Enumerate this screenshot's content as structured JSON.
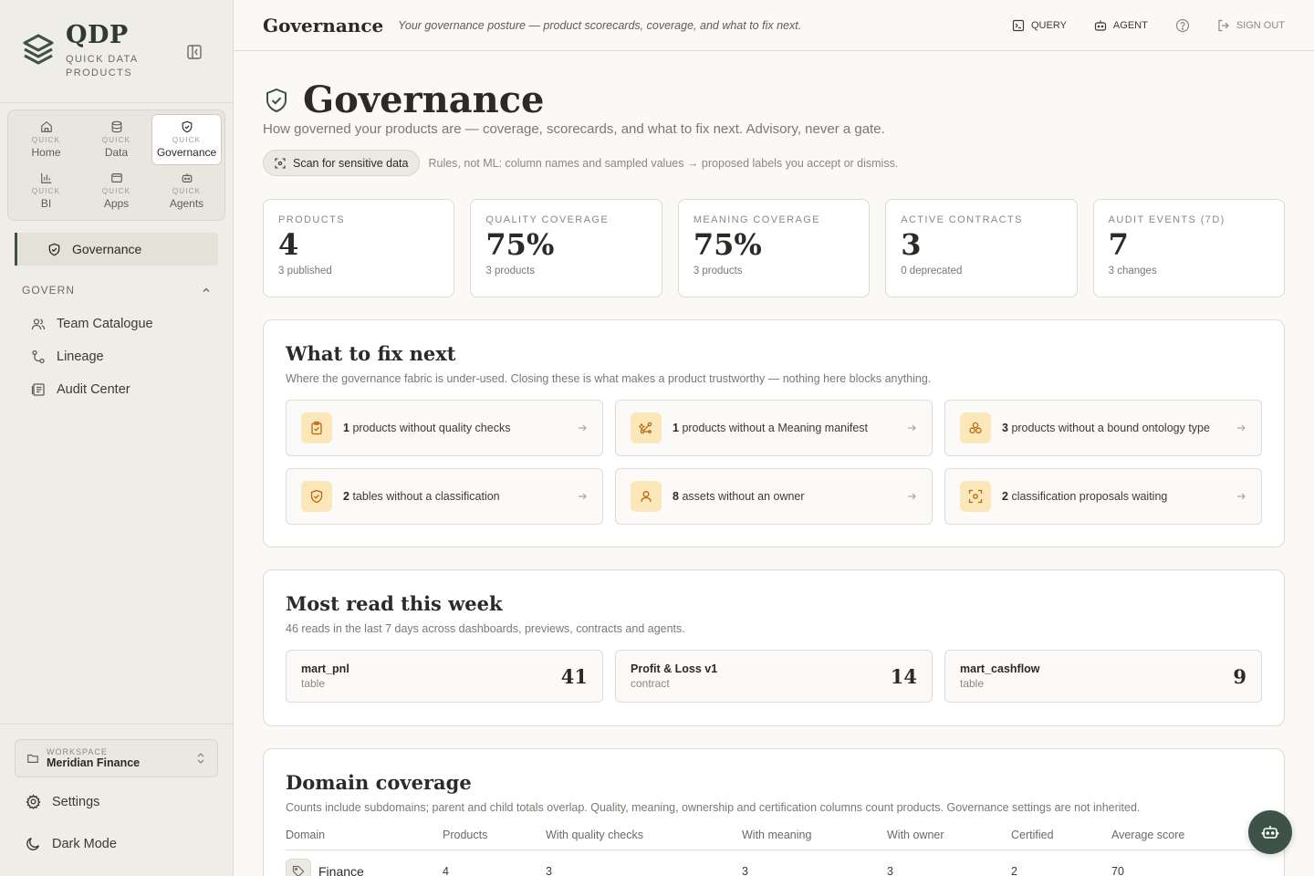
{
  "brand": {
    "title": "QDP",
    "subtitle": "QUICK DATA PRODUCTS"
  },
  "app_switcher": [
    {
      "prefix": "QUICK",
      "label": "Home",
      "icon": "home-icon"
    },
    {
      "prefix": "QUICK",
      "label": "Data",
      "icon": "database-icon"
    },
    {
      "prefix": "QUICK",
      "label": "Governance",
      "icon": "shield-check-icon",
      "active": true
    },
    {
      "prefix": "QUICK",
      "label": "BI",
      "icon": "bar-chart-icon"
    },
    {
      "prefix": "QUICK",
      "label": "Apps",
      "icon": "window-icon"
    },
    {
      "prefix": "QUICK",
      "label": "Agents",
      "icon": "robot-icon"
    }
  ],
  "sidebar": {
    "active_item": "Governance",
    "section": "GOVERN",
    "items": [
      "Team Catalogue",
      "Lineage",
      "Audit Center"
    ],
    "workspace_label": "WORKSPACE",
    "workspace_name": "Meridian Finance",
    "settings": "Settings",
    "dark_mode": "Dark Mode"
  },
  "topbar": {
    "title": "Governance",
    "subtitle": "Your governance posture — product scorecards, coverage, and what to fix next.",
    "query": "QUERY",
    "agent": "AGENT",
    "sign_out": "SIGN OUT"
  },
  "page": {
    "title": "Governance",
    "description": "How governed your products are — coverage, scorecards, and what to fix next. Advisory, never a gate.",
    "scan_button": "Scan for sensitive data",
    "scan_note": "Rules, not ML: column names and sampled values → proposed labels you accept or dismiss."
  },
  "stats": [
    {
      "label": "PRODUCTS",
      "value": "4",
      "sub": "3 published"
    },
    {
      "label": "QUALITY COVERAGE",
      "value": "75%",
      "sub": "3 products"
    },
    {
      "label": "MEANING COVERAGE",
      "value": "75%",
      "sub": "3 products"
    },
    {
      "label": "ACTIVE CONTRACTS",
      "value": "3",
      "sub": "0 deprecated"
    },
    {
      "label": "AUDIT EVENTS (7D)",
      "value": "7",
      "sub": "3 changes"
    }
  ],
  "fix_next": {
    "title": "What to fix next",
    "description": "Where the governance fabric is under-used. Closing these is what makes a product trustworthy — nothing here blocks anything.",
    "items": [
      {
        "count": "1",
        "text": "products without quality checks",
        "icon": "clipboard-check-icon"
      },
      {
        "count": "1",
        "text": "products without a Meaning manifest",
        "icon": "sparkle-nodes-icon"
      },
      {
        "count": "3",
        "text": "products without a bound ontology type",
        "icon": "cubes-icon"
      },
      {
        "count": "2",
        "text": "tables without a classification",
        "icon": "shield-check-icon"
      },
      {
        "count": "8",
        "text": "assets without an owner",
        "icon": "user-icon"
      },
      {
        "count": "2",
        "text": "classification proposals waiting",
        "icon": "scan-icon"
      }
    ]
  },
  "most_read": {
    "title": "Most read this week",
    "description": "46 reads in the last 7 days across dashboards, previews, contracts and agents.",
    "items": [
      {
        "name": "mart_pnl",
        "kind": "table",
        "count": "41"
      },
      {
        "name": "Profit & Loss v1",
        "kind": "contract",
        "count": "14"
      },
      {
        "name": "mart_cashflow",
        "kind": "table",
        "count": "9"
      }
    ]
  },
  "domain_coverage": {
    "title": "Domain coverage",
    "description": "Counts include subdomains; parent and child totals overlap. Quality, meaning, ownership and certification columns count products. Governance settings are not inherited.",
    "columns": [
      "Domain",
      "Products",
      "With quality checks",
      "With meaning",
      "With owner",
      "Certified",
      "Average score"
    ],
    "rows": [
      [
        "Finance",
        "4",
        "3",
        "3",
        "3",
        "2",
        "70"
      ]
    ]
  },
  "colors": {
    "accent": "#3e5248",
    "warning_bg": "#fbe7b9",
    "warning_fg": "#b8680f"
  }
}
